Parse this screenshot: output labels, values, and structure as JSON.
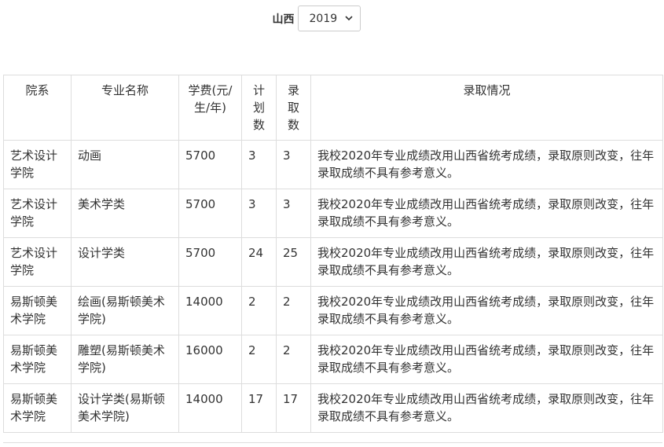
{
  "filter": {
    "province_label": "山西",
    "year_selected": "2019"
  },
  "table": {
    "headers": [
      "院系",
      "专业名称",
      "学费(元/生/年)",
      "计划数",
      "录取数",
      "录取情况"
    ],
    "rows": [
      [
        "艺术设计学院",
        "动画",
        "5700",
        "3",
        "3",
        "我校2020年专业成绩改用山西省统考成绩，录取原则改变，往年录取成绩不具有参考意义。"
      ],
      [
        "艺术设计学院",
        "美术学类",
        "5700",
        "3",
        "3",
        "我校2020年专业成绩改用山西省统考成绩，录取原则改变，往年录取成绩不具有参考意义。"
      ],
      [
        "艺术设计学院",
        "设计学类",
        "5700",
        "24",
        "25",
        "我校2020年专业成绩改用山西省统考成绩，录取原则改变，往年录取成绩不具有参考意义。"
      ],
      [
        "易斯顿美术学院",
        "绘画(易斯顿美术学院)",
        "14000",
        "2",
        "2",
        "我校2020年专业成绩改用山西省统考成绩，录取原则改变，往年录取成绩不具有参考意义。"
      ],
      [
        "易斯顿美术学院",
        "雕塑(易斯顿美术学院)",
        "16000",
        "2",
        "2",
        "我校2020年专业成绩改用山西省统考成绩，录取原则改变，往年录取成绩不具有参考意义。"
      ],
      [
        "易斯顿美术学院",
        "设计学类(易斯顿美术学院)",
        "14000",
        "17",
        "17",
        "我校2020年专业成绩改用山西省统考成绩，录取原则改变，往年录取成绩不具有参考意义。"
      ]
    ]
  }
}
